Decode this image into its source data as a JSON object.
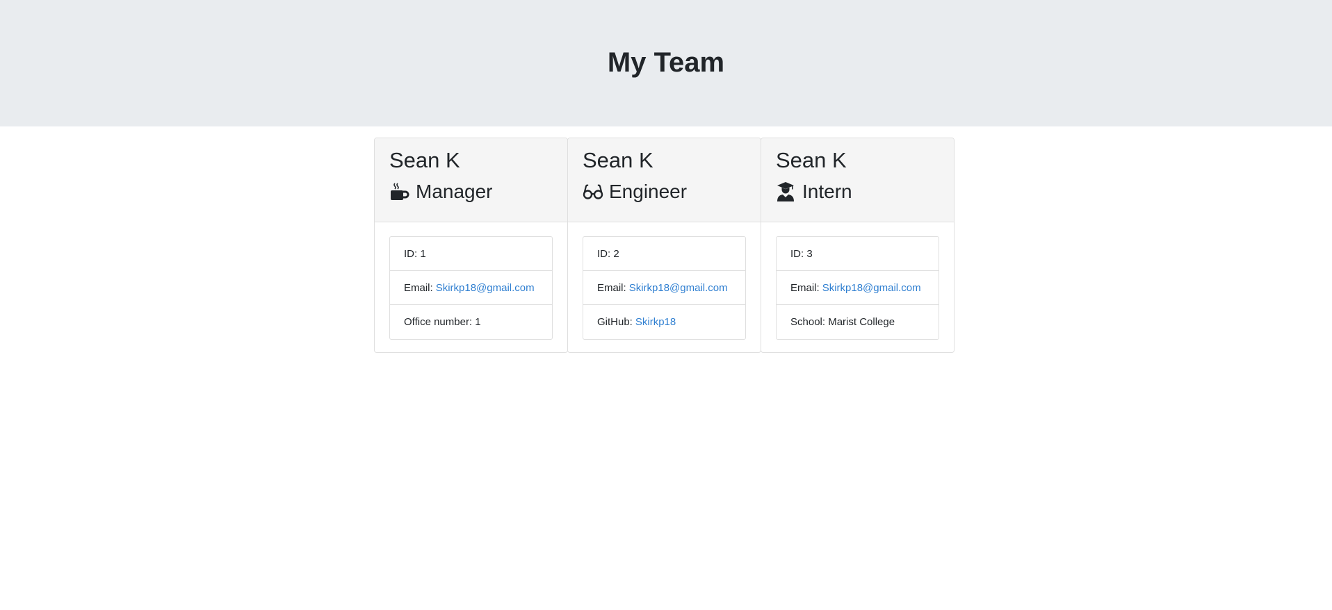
{
  "header": {
    "title": "My Team"
  },
  "team": [
    {
      "name": "Sean K",
      "role": "Manager",
      "role_icon": "coffee-mug-icon",
      "id_label": "ID: 1",
      "email_label": "Email:",
      "email": "Skirkp18@gmail.com",
      "extra_label": "Office number: 1",
      "extra_link": ""
    },
    {
      "name": "Sean K",
      "role": "Engineer",
      "role_icon": "glasses-icon",
      "id_label": "ID: 2",
      "email_label": "Email:",
      "email": "Skirkp18@gmail.com",
      "extra_label": "GitHub:",
      "extra_link": "Skirkp18"
    },
    {
      "name": "Sean K",
      "role": "Intern",
      "role_icon": "graduate-icon",
      "id_label": "ID: 3",
      "email_label": "Email:",
      "email": "Skirkp18@gmail.com",
      "extra_label": "School: Marist College",
      "extra_link": ""
    }
  ],
  "colors": {
    "header_bg": "#e9ecef",
    "card_header_bg": "#f5f5f5",
    "link": "#2f7fd1",
    "text": "#212529"
  }
}
